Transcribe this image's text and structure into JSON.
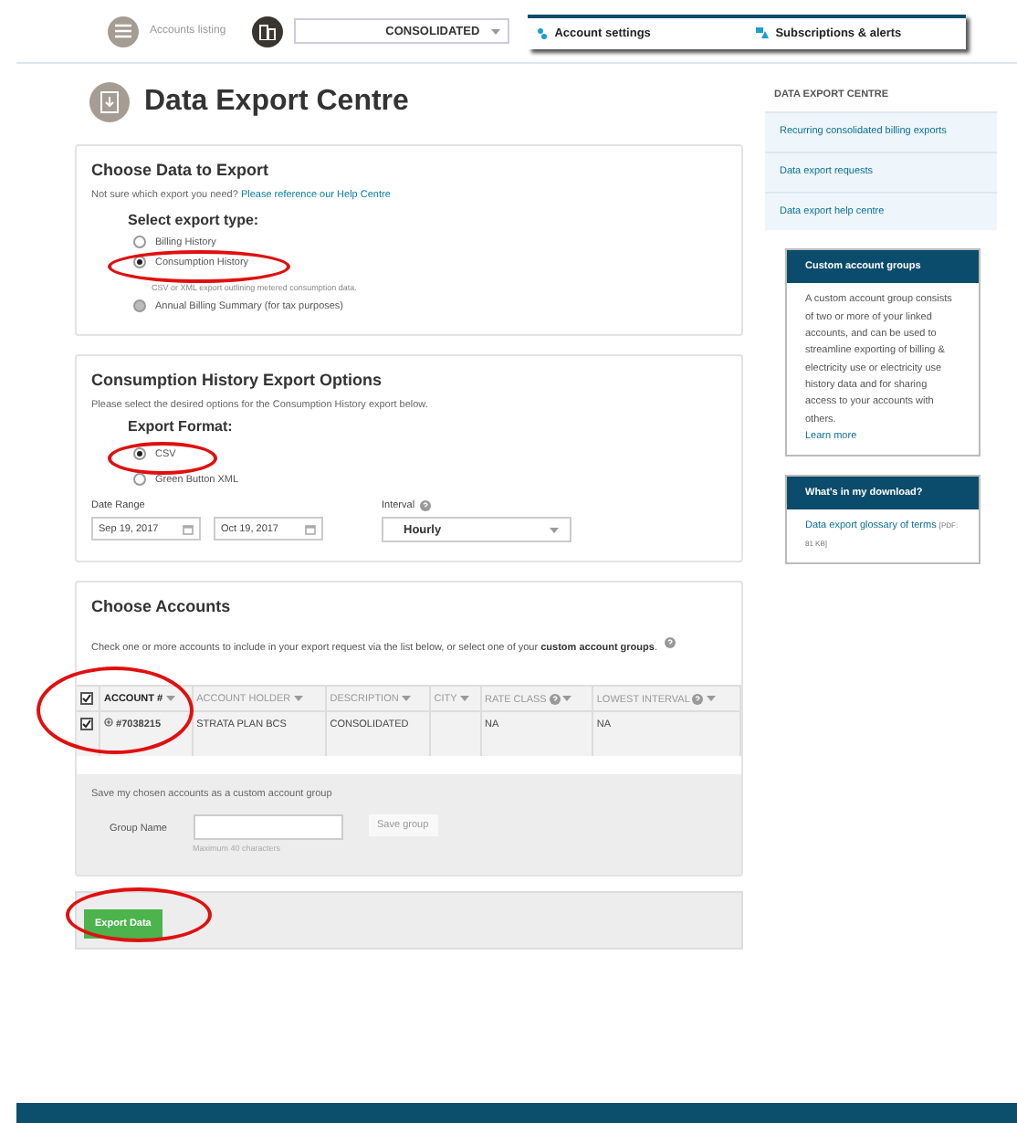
{
  "header": {
    "accounts_listing": "Accounts listing",
    "account_select": "CONSOLIDATED",
    "tabs": [
      {
        "label": "Account settings",
        "kind": "settings"
      },
      {
        "label": "Subscriptions & alerts",
        "kind": "alerts"
      }
    ]
  },
  "page_title": "Data Export Centre",
  "choose_data": {
    "title": "Choose Data to Export",
    "help_text": "Not sure which export you need?",
    "help_link": "Please reference our Help Centre",
    "subtitle": "Select export type:",
    "options": [
      {
        "label": "Billing History",
        "selected": false,
        "disabled": false,
        "circled": false
      },
      {
        "label": "Consumption History",
        "description": "CSV or XML export outlining metered consumption data.",
        "selected": true,
        "disabled": false,
        "circled": true
      },
      {
        "label": "Annual Billing Summary (for tax purposes)",
        "selected": false,
        "disabled": true,
        "circled": false
      }
    ]
  },
  "export_options": {
    "title": "Consumption History Export Options",
    "intro": "Please select the desired options for the Consumption History export below.",
    "format_label": "Export Format:",
    "formats": [
      {
        "label": "CSV",
        "selected": true,
        "circled": true
      },
      {
        "label": "Green Button XML",
        "selected": false,
        "circled": false
      }
    ],
    "date_range_label": "Date Range",
    "start_date": "Sep 19, 2017",
    "end_date": "Oct 19, 2017",
    "interval_label": "Interval",
    "interval": "Hourly"
  },
  "accounts": {
    "title": "Choose Accounts",
    "intro": "Check one or more accounts to include in your export request via the list below, or select one of your **custom account groups**.",
    "table": {
      "circled": true,
      "all_checked": true,
      "columns": [
        {
          "label": "ACCOUNT #",
          "sorted": true,
          "help": false
        },
        {
          "label": "ACCOUNT HOLDER",
          "sorted": false,
          "help": false
        },
        {
          "label": "DESCRIPTION",
          "sorted": false,
          "help": false
        },
        {
          "label": "CITY",
          "sorted": false,
          "help": false
        },
        {
          "label": "RATE CLASS",
          "sorted": false,
          "help": true
        },
        {
          "label": "LOWEST INTERVAL",
          "sorted": false,
          "help": true
        }
      ],
      "rows": [
        {
          "checked": true,
          "account": "#7038215",
          "holder": "STRATA PLAN BCS",
          "description": "CONSOLIDATED",
          "rate_class": "NA",
          "lowest_interval": "NA"
        }
      ]
    },
    "save_text": "Save my chosen accounts as a custom account group",
    "group_label": "Group Name",
    "group_hint": "Maximum 40 characters",
    "save_button": {
      "label": "Save group",
      "disabled": true
    }
  },
  "export_button": {
    "label": "Export Data",
    "circled": true
  },
  "sidebar": {
    "heading": "DATA EXPORT CENTRE",
    "links": [
      "Recurring consolidated billing exports",
      "Data export requests",
      "Data export help centre"
    ],
    "boxes": [
      {
        "title": "Custom account groups",
        "body": "A custom account group consists of two or more of your linked accounts, and can be used to streamline exporting of billing & electricity use or electricity use history data and for sharing access to your accounts with others.",
        "link": "Learn more"
      },
      {
        "title": "What's in my download?",
        "link": "Data export glossary of terms",
        "note": "[PDF: 81 KB]"
      }
    ]
  }
}
